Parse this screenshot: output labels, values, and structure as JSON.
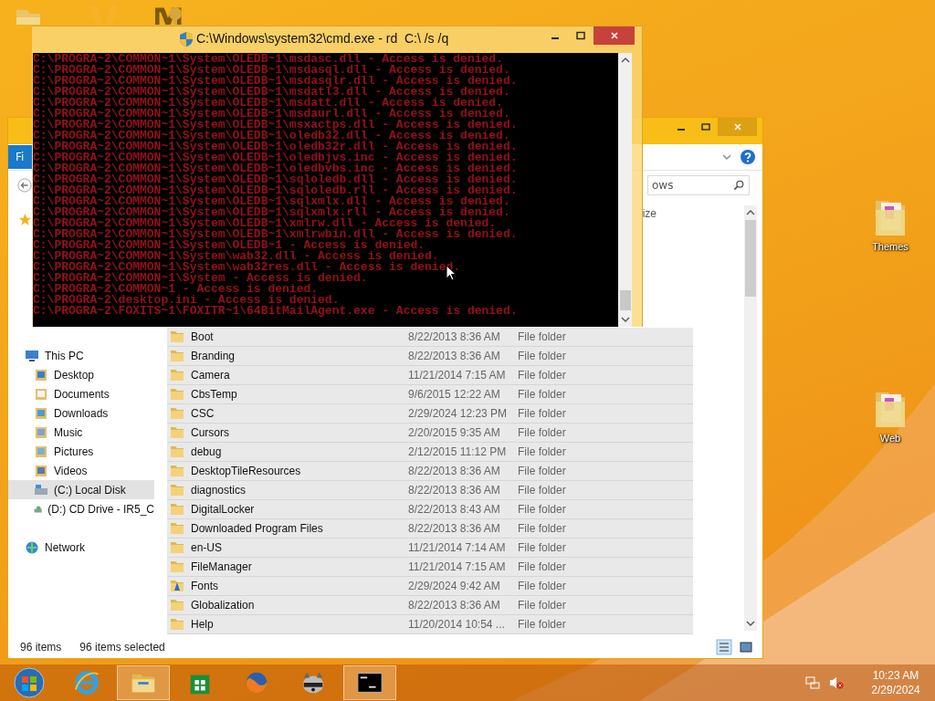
{
  "desktop_icons": [
    {
      "label": "Themes"
    },
    {
      "label": "Web"
    }
  ],
  "cmd_window": {
    "title": "C:\\Windows\\system32\\cmd.exe - rd  C:\\ /s /q",
    "lines": [
      "C:\\PROGRA~2\\COMMON~1\\System\\OLEDB~1\\msdasc.dll - Access is denied.",
      "C:\\PROGRA~2\\COMMON~1\\System\\OLEDB~1\\msdasql.dll - Access is denied.",
      "C:\\PROGRA~2\\COMMON~1\\System\\OLEDB~1\\msdasqlr.dll - Access is denied.",
      "C:\\PROGRA~2\\COMMON~1\\System\\OLEDB~1\\msdatl3.dll - Access is denied.",
      "C:\\PROGRA~2\\COMMON~1\\System\\OLEDB~1\\msdatt.dll - Access is denied.",
      "C:\\PROGRA~2\\COMMON~1\\System\\OLEDB~1\\msdaurl.dll - Access is denied.",
      "C:\\PROGRA~2\\COMMON~1\\System\\OLEDB~1\\msxactps.dll - Access is denied.",
      "C:\\PROGRA~2\\COMMON~1\\System\\OLEDB~1\\oledb32.dll - Access is denied.",
      "C:\\PROGRA~2\\COMMON~1\\System\\OLEDB~1\\oledb32r.dll - Access is denied.",
      "C:\\PROGRA~2\\COMMON~1\\System\\OLEDB~1\\oledbjvs.inc - Access is denied.",
      "C:\\PROGRA~2\\COMMON~1\\System\\OLEDB~1\\oledbvbs.inc - Access is denied.",
      "C:\\PROGRA~2\\COMMON~1\\System\\OLEDB~1\\sqloledb.dll - Access is denied.",
      "C:\\PROGRA~2\\COMMON~1\\System\\OLEDB~1\\sqloledb.rll - Access is denied.",
      "C:\\PROGRA~2\\COMMON~1\\System\\OLEDB~1\\sqlxmlx.dll - Access is denied.",
      "C:\\PROGRA~2\\COMMON~1\\System\\OLEDB~1\\sqlxmlx.rll - Access is denied.",
      "C:\\PROGRA~2\\COMMON~1\\System\\OLEDB~1\\xmlrw.dll - Access is denied.",
      "C:\\PROGRA~2\\COMMON~1\\System\\OLEDB~1\\xmlrwbin.dll - Access is denied.",
      "C:\\PROGRA~2\\COMMON~1\\System\\OLEDB~1 - Access is denied.",
      "C:\\PROGRA~2\\COMMON~1\\System\\wab32.dll - Access is denied.",
      "C:\\PROGRA~2\\COMMON~1\\System\\wab32res.dll - Access is denied.",
      "C:\\PROGRA~2\\COMMON~1\\System - Access is denied.",
      "C:\\PROGRA~2\\COMMON~1 - Access is denied.",
      "C:\\PROGRA~2\\desktop.ini - Access is denied.",
      "C:\\PROGRA~2\\FOXITS~1\\FOXITR~1\\64BitMailAgent.exe - Access is denied."
    ]
  },
  "explorer": {
    "ribbon_tab": "Fi",
    "search": {
      "placeholder": "ows"
    },
    "column_4": "ize",
    "nav": [
      {
        "label": "This PC",
        "kind": "pc",
        "selected": false,
        "children": [
          {
            "label": "Desktop",
            "kind": "desktop",
            "selected": false
          },
          {
            "label": "Documents",
            "kind": "documents",
            "selected": false
          },
          {
            "label": "Downloads",
            "kind": "downloads",
            "selected": false
          },
          {
            "label": "Music",
            "kind": "music",
            "selected": false
          },
          {
            "label": "Pictures",
            "kind": "pictures",
            "selected": false
          },
          {
            "label": "Videos",
            "kind": "videos",
            "selected": false
          },
          {
            "label": "(C:) Local Disk",
            "kind": "disk",
            "selected": true
          },
          {
            "label": "(D:) CD Drive - IR5_C",
            "kind": "cd",
            "selected": false
          }
        ]
      },
      {
        "label": "Network",
        "kind": "network",
        "selected": false
      }
    ],
    "rows": [
      {
        "name": "Boot",
        "date": "8/22/2013 8:36 AM",
        "type": "File folder",
        "kind": "folder",
        "selected": true
      },
      {
        "name": "Branding",
        "date": "8/22/2013 8:36 AM",
        "type": "File folder",
        "kind": "folder",
        "selected": true
      },
      {
        "name": "Camera",
        "date": "11/21/2014 7:15 AM",
        "type": "File folder",
        "kind": "folder",
        "selected": true
      },
      {
        "name": "CbsTemp",
        "date": "9/6/2015 12:22 AM",
        "type": "File folder",
        "kind": "folder",
        "selected": true
      },
      {
        "name": "CSC",
        "date": "2/29/2024 12:23 PM",
        "type": "File folder",
        "kind": "folder",
        "selected": true
      },
      {
        "name": "Cursors",
        "date": "2/20/2015 9:35 AM",
        "type": "File folder",
        "kind": "folder",
        "selected": true
      },
      {
        "name": "debug",
        "date": "2/12/2015 11:12 PM",
        "type": "File folder",
        "kind": "folder",
        "selected": true
      },
      {
        "name": "DesktopTileResources",
        "date": "8/22/2013 8:36 AM",
        "type": "File folder",
        "kind": "folder",
        "selected": true
      },
      {
        "name": "diagnostics",
        "date": "8/22/2013 8:36 AM",
        "type": "File folder",
        "kind": "folder",
        "selected": true
      },
      {
        "name": "DigitalLocker",
        "date": "8/22/2013 8:43 AM",
        "type": "File folder",
        "kind": "folder",
        "selected": true
      },
      {
        "name": "Downloaded Program Files",
        "date": "8/22/2013 8:36 AM",
        "type": "File folder",
        "kind": "folder",
        "selected": true
      },
      {
        "name": "en-US",
        "date": "11/21/2014 7:14 AM",
        "type": "File folder",
        "kind": "folder",
        "selected": true
      },
      {
        "name": "FileManager",
        "date": "11/21/2014 7:15 AM",
        "type": "File folder",
        "kind": "folder",
        "selected": true
      },
      {
        "name": "Fonts",
        "date": "2/29/2024 9:42 AM",
        "type": "File folder",
        "kind": "fonts",
        "selected": true
      },
      {
        "name": "Globalization",
        "date": "8/22/2013 8:36 AM",
        "type": "File folder",
        "kind": "folder",
        "selected": true
      },
      {
        "name": "Help",
        "date": "11/20/2014 10:54 ...",
        "type": "File folder",
        "kind": "folder",
        "selected": true
      }
    ],
    "status": {
      "count": "96 items",
      "selection": "96 items selected"
    }
  },
  "taskbar": {
    "apps": [
      {
        "kind": "ie",
        "selected": false
      },
      {
        "kind": "explorer",
        "selected": true
      },
      {
        "kind": "store",
        "selected": false
      },
      {
        "kind": "firefox",
        "selected": false
      },
      {
        "kind": "raccoon",
        "selected": false
      },
      {
        "kind": "cmd",
        "selected": true
      }
    ],
    "time": "10:23 AM",
    "date": "2/29/2024"
  }
}
